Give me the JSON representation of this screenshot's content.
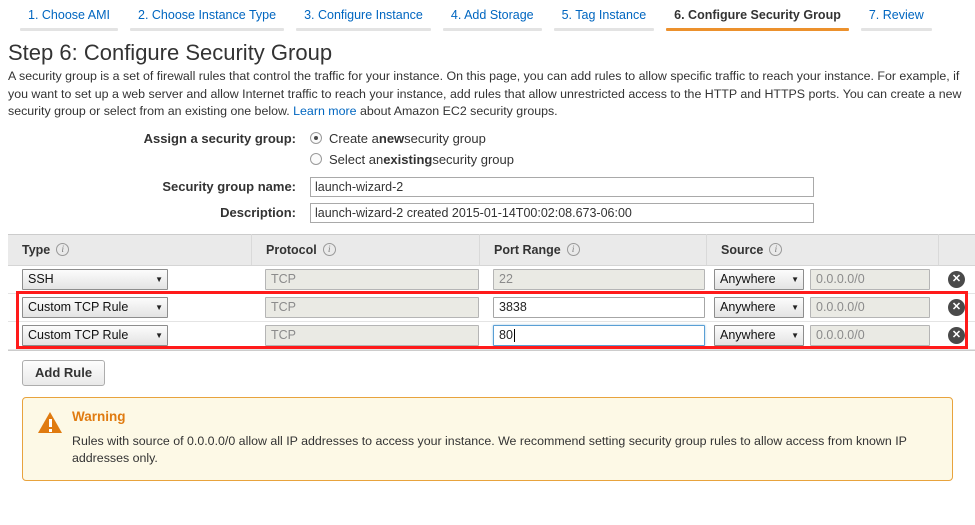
{
  "wizard": {
    "tabs": [
      {
        "label": "1. Choose AMI",
        "active": false
      },
      {
        "label": "2. Choose Instance Type",
        "active": false
      },
      {
        "label": "3. Configure Instance",
        "active": false
      },
      {
        "label": "4. Add Storage",
        "active": false
      },
      {
        "label": "5. Tag Instance",
        "active": false
      },
      {
        "label": "6. Configure Security Group",
        "active": true
      },
      {
        "label": "7. Review",
        "active": false
      }
    ],
    "active_accent_color": "#ec912d"
  },
  "page": {
    "title": "Step 6: Configure Security Group",
    "intro_part1": "A security group is a set of firewall rules that control the traffic for your instance. On this page, you can add rules to allow specific traffic to reach your instance. For example, if you want to set up a web server and allow Internet traffic to reach your instance, add rules that allow unrestricted access to the HTTP and HTTPS ports. You can create a new security group or select from an existing one below. ",
    "intro_link": "Learn more",
    "intro_part2": " about Amazon EC2 security groups."
  },
  "assign": {
    "label": "Assign a security group:",
    "option_new_prefix": "Create a ",
    "option_new_bold": "new",
    "option_new_suffix": " security group",
    "option_existing_prefix": "Select an ",
    "option_existing_bold": "existing",
    "option_existing_suffix": " security group",
    "selected": "new"
  },
  "fields": {
    "name_label": "Security group name:",
    "name_value": "launch-wizard-2",
    "desc_label": "Description:",
    "desc_value": "launch-wizard-2 created 2015-01-14T00:02:08.673-06:00"
  },
  "rules_table": {
    "headers": {
      "type": "Type",
      "protocol": "Protocol",
      "port_range": "Port Range",
      "source": "Source"
    },
    "info_glyph": "i",
    "delete_glyph": "✕",
    "caret_glyph": "▼",
    "rows": [
      {
        "type": "SSH",
        "protocol": "TCP",
        "port_range": "22",
        "port_editable": false,
        "port_focused": false,
        "source_mode": "Anywhere",
        "source_cidr": "0.0.0.0/0",
        "highlighted": false
      },
      {
        "type": "Custom TCP Rule",
        "protocol": "TCP",
        "port_range": "3838",
        "port_editable": true,
        "port_focused": false,
        "source_mode": "Anywhere",
        "source_cidr": "0.0.0.0/0",
        "highlighted": true
      },
      {
        "type": "Custom TCP Rule",
        "protocol": "TCP",
        "port_range": "80",
        "port_editable": true,
        "port_focused": true,
        "source_mode": "Anywhere",
        "source_cidr": "0.0.0.0/0",
        "highlighted": true
      }
    ],
    "highlight_color": "#ff1a1a"
  },
  "add_rule_label": "Add Rule",
  "warning": {
    "title": "Warning",
    "text": "Rules with source of 0.0.0.0/0 allow all IP addresses to access your instance. We recommend setting security group rules to allow access from known IP addresses only.",
    "accent_color": "#e07b10"
  }
}
